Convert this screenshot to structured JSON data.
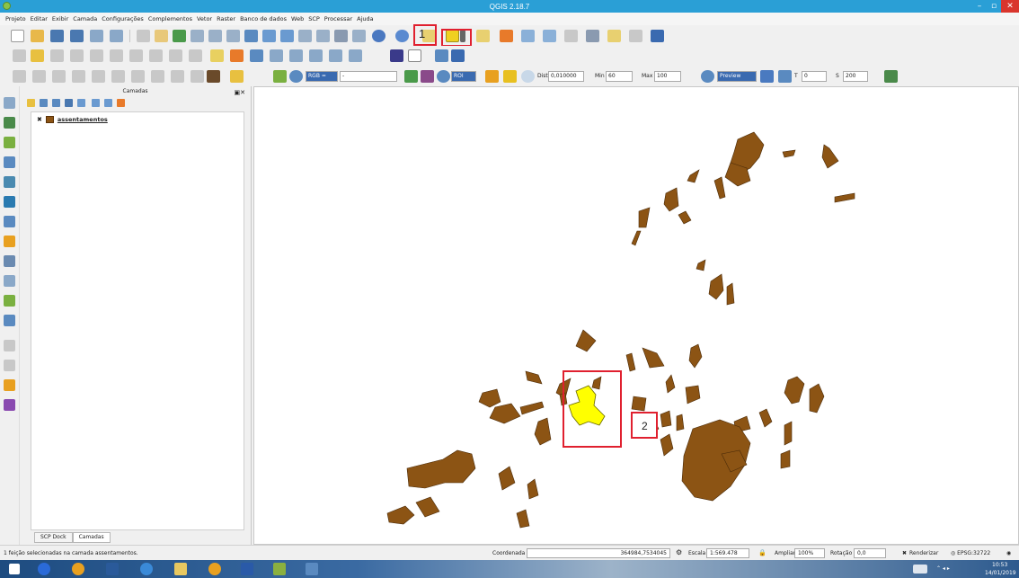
{
  "window": {
    "title": "QGIS 2.18.7",
    "minimize": "–",
    "maximize": "▫",
    "close": "✕"
  },
  "menu": [
    "Projeto",
    "Editar",
    "Exibir",
    "Camada",
    "Configurações",
    "Complementos",
    "Vetor",
    "Raster",
    "Banco de dados",
    "Web",
    "SCP",
    "Processar",
    "Ajuda"
  ],
  "annotations": {
    "step1": "1",
    "step2": "2"
  },
  "toolbar3": {
    "rgb": "RGB =",
    "rgb_value": "-",
    "roi_label": "ROI",
    "dist_label": "Dist",
    "dist_value": "0,010000",
    "min_label": "Min",
    "min_value": "60",
    "max_label": "Max",
    "max_value": "100",
    "preview_label": "Preview",
    "t_label": "T",
    "t_value": "0",
    "s_label": "S",
    "s_value": "200"
  },
  "layers_panel": {
    "title": "Camadas",
    "layer": {
      "name": "assentamentos",
      "checked": "✖"
    },
    "tabs": [
      "SCP Dock",
      "Camadas"
    ]
  },
  "status": {
    "message": "1 feição selecionadas na camada assentamentos.",
    "coord_label": "Coordenada",
    "coord_value": "364984,7534045",
    "scale_label": "Escala",
    "scale_value": "1:569.478",
    "zoom_label": "Ampliar",
    "zoom_value": "100%",
    "rotation_label": "Rotação",
    "rotation_value": "0,0",
    "render_label": "Renderizar",
    "crs": "EPSG:32722"
  },
  "taskbar": {
    "time": "10:53",
    "date": "14/01/2019"
  },
  "colors": {
    "polygon_fill": "#8c5414",
    "polygon_stroke": "#4a2a08",
    "selected_fill": "#ffff00",
    "highlight": "#e0202f"
  }
}
